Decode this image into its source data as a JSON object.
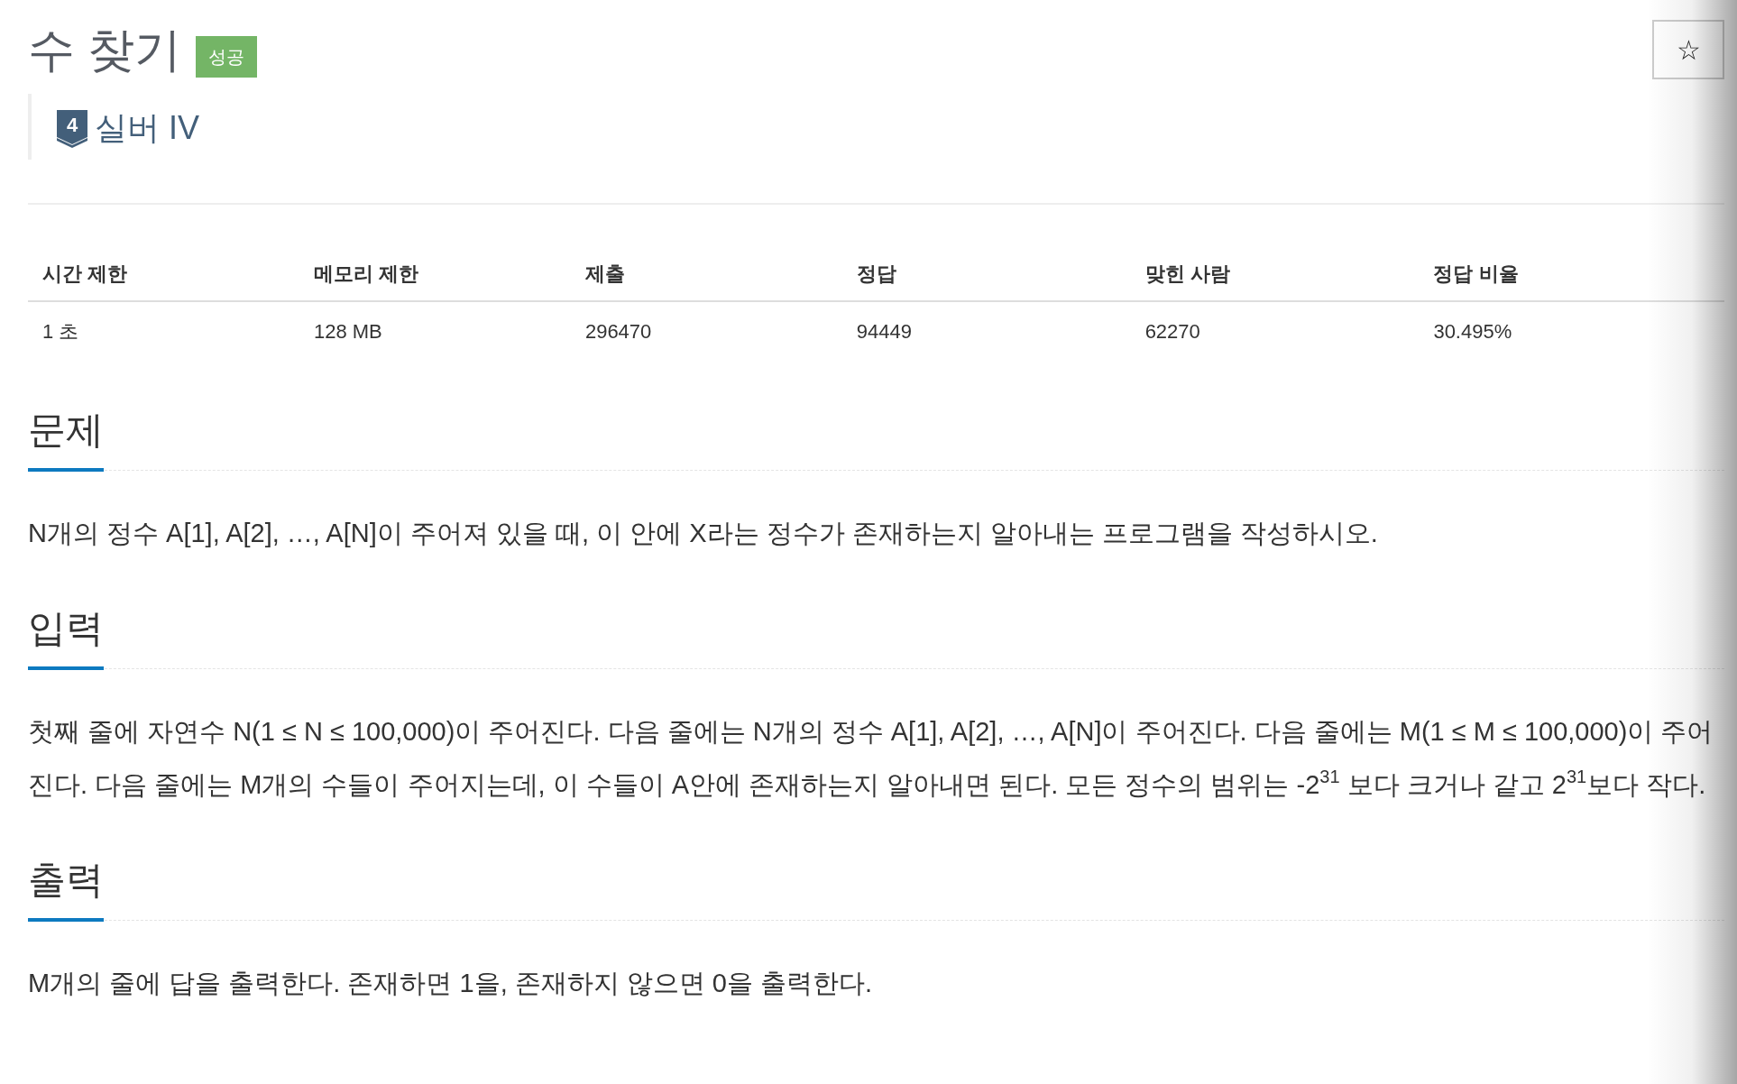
{
  "title": "수 찾기",
  "result_badge": {
    "label": "성공",
    "kind": "success"
  },
  "tier": {
    "number": "4",
    "label": "실버 IV"
  },
  "favorite": {
    "icon": "☆",
    "selected": false
  },
  "table": {
    "columns": [
      "시간 제한",
      "메모리 제한",
      "제출",
      "정답",
      "맞힌 사람",
      "정답 비율"
    ],
    "rows": [
      [
        "1 초",
        "128 MB",
        "296470",
        "94449",
        "62270",
        "30.495%"
      ]
    ]
  },
  "sections": [
    {
      "heading": "문제",
      "paragraphs": [
        "N개의 정수 A[1], A[2], …, A[N]이 주어져 있을 때, 이 안에 X라는 정수가 존재하는지 알아내는 프로그램을 작성하시오."
      ]
    },
    {
      "heading": "입력",
      "paragraphs": [
        "첫째 줄에 자연수 N(1 ≤ N ≤ 100,000)이 주어진다. 다음 줄에는 N개의 정수 A[1], A[2], …, A[N]이 주어진다. 다음 줄에는 M(1 ≤ M ≤ 100,000)이 주어진다. 다음 줄에는 M개의 수들이 주어지는데, 이 수들이 A안에 존재하는지 알아내면 된다. 모든 정수의 범위는 -2$^{31}$ 보다 크거나 같고 2$^{31}$보다 작다."
      ]
    },
    {
      "heading": "출력",
      "paragraphs": [
        "M개의 줄에 답을 출력한다. 존재하면 1을, 존재하지 않으면 0을 출력한다."
      ]
    }
  ]
}
